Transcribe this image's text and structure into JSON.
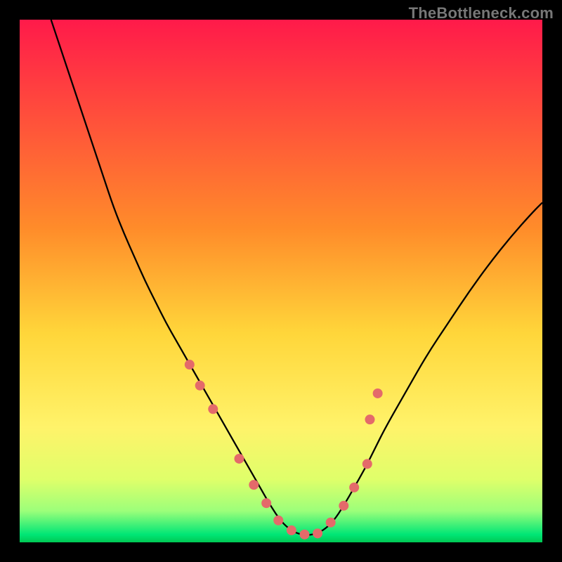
{
  "watermark": "TheBottleneck.com",
  "chart_data": {
    "type": "line",
    "title": "",
    "xlabel": "",
    "ylabel": "",
    "xlim": [
      0,
      100
    ],
    "ylim": [
      0,
      100
    ],
    "grid": false,
    "legend": false,
    "background_gradient": {
      "stops": [
        {
          "offset": 0.0,
          "color": "#ff1a4a"
        },
        {
          "offset": 0.4,
          "color": "#ff8c2a"
        },
        {
          "offset": 0.6,
          "color": "#ffd63a"
        },
        {
          "offset": 0.78,
          "color": "#fff36a"
        },
        {
          "offset": 0.88,
          "color": "#dfff6a"
        },
        {
          "offset": 0.94,
          "color": "#9cff7a"
        },
        {
          "offset": 0.985,
          "color": "#00e676"
        },
        {
          "offset": 1.0,
          "color": "#00c853"
        }
      ]
    },
    "series": [
      {
        "name": "curve",
        "type": "line",
        "color": "#000000",
        "x": [
          6,
          8,
          10,
          12,
          14,
          16,
          18,
          20,
          22,
          24,
          26,
          28,
          30,
          32,
          34,
          36,
          38,
          40,
          42,
          44,
          46,
          48,
          50,
          52,
          54,
          56,
          58,
          60,
          62,
          64,
          66,
          68,
          70,
          74,
          78,
          82,
          86,
          90,
          94,
          98,
          100
        ],
        "y": [
          100,
          94,
          88,
          82,
          76,
          70,
          64,
          59,
          54.5,
          50,
          46,
          42,
          38.5,
          35,
          31.5,
          28,
          24.5,
          21,
          17.5,
          14,
          10.5,
          7,
          4,
          2.2,
          1.4,
          1.4,
          2.2,
          4,
          7,
          10.5,
          14,
          18,
          22,
          29,
          36,
          42,
          48,
          53.5,
          58.5,
          63,
          65
        ]
      },
      {
        "name": "markers",
        "type": "scatter",
        "color": "#e46a6a",
        "radius": 7,
        "x": [
          32.5,
          34.5,
          37.0,
          42.0,
          44.8,
          47.2,
          49.5,
          52.0,
          54.5,
          57.0,
          59.5,
          62.0,
          64.0,
          66.5,
          67.0,
          68.5
        ],
        "y": [
          34.0,
          30.0,
          25.5,
          16.0,
          11.0,
          7.5,
          4.2,
          2.3,
          1.5,
          1.7,
          3.8,
          7.0,
          10.5,
          15.0,
          23.5,
          28.5
        ]
      }
    ]
  }
}
